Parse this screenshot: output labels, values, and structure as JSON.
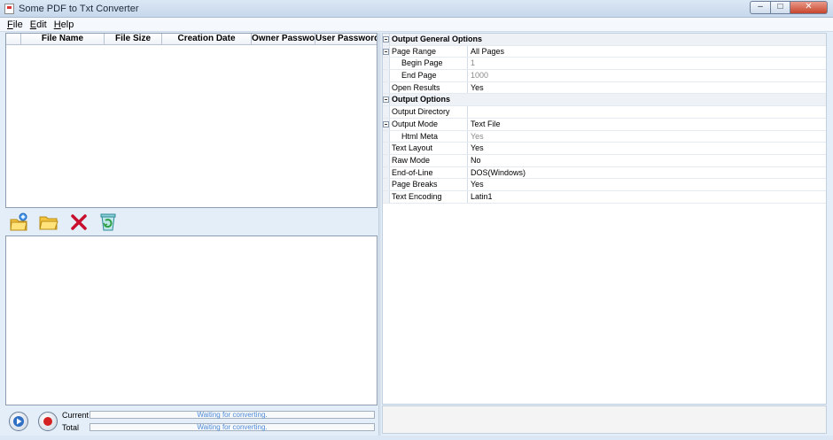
{
  "window": {
    "title": "Some PDF to Txt Converter"
  },
  "menu": [
    {
      "mnemonic": "F",
      "rest": "ile"
    },
    {
      "mnemonic": "E",
      "rest": "dit"
    },
    {
      "mnemonic": "H",
      "rest": "elp"
    }
  ],
  "file_table": {
    "columns": [
      "File Name",
      "File Size",
      "Creation Date",
      "Owner Password",
      "User Password"
    ]
  },
  "toolbar": {
    "icons": [
      "add-file-icon",
      "open-folder-icon",
      "remove-icon",
      "clear-list-icon"
    ]
  },
  "progress": {
    "current_label": "Current",
    "total_label": "Total",
    "current_status": "Waiting for converting.",
    "total_status": "Waiting for converting."
  },
  "properties": {
    "general_header": "Output General Options",
    "page_range_label": "Page Range",
    "page_range_value": "All Pages",
    "begin_page_label": "Begin Page",
    "begin_page_value": "1",
    "end_page_label": "End Page",
    "end_page_value": "1000",
    "open_results_label": "Open Results",
    "open_results_value": "Yes",
    "output_header": "Output Options",
    "output_directory_label": "Output Directory",
    "output_directory_value": "",
    "output_mode_label": "Output Mode",
    "output_mode_value": "Text File",
    "html_meta_label": "Html Meta",
    "html_meta_value": "Yes",
    "text_layout_label": "Text Layout",
    "text_layout_value": "Yes",
    "raw_mode_label": "Raw Mode",
    "raw_mode_value": "No",
    "eol_label": "End-of-Line",
    "eol_value": "DOS(Windows)",
    "page_breaks_label": "Page Breaks",
    "page_breaks_value": "Yes",
    "text_encoding_label": "Text Encoding",
    "text_encoding_value": "Latin1"
  },
  "colors": {
    "accent": "#4d8ad6",
    "remove": "#c8102e",
    "folder": "#f3c440"
  }
}
